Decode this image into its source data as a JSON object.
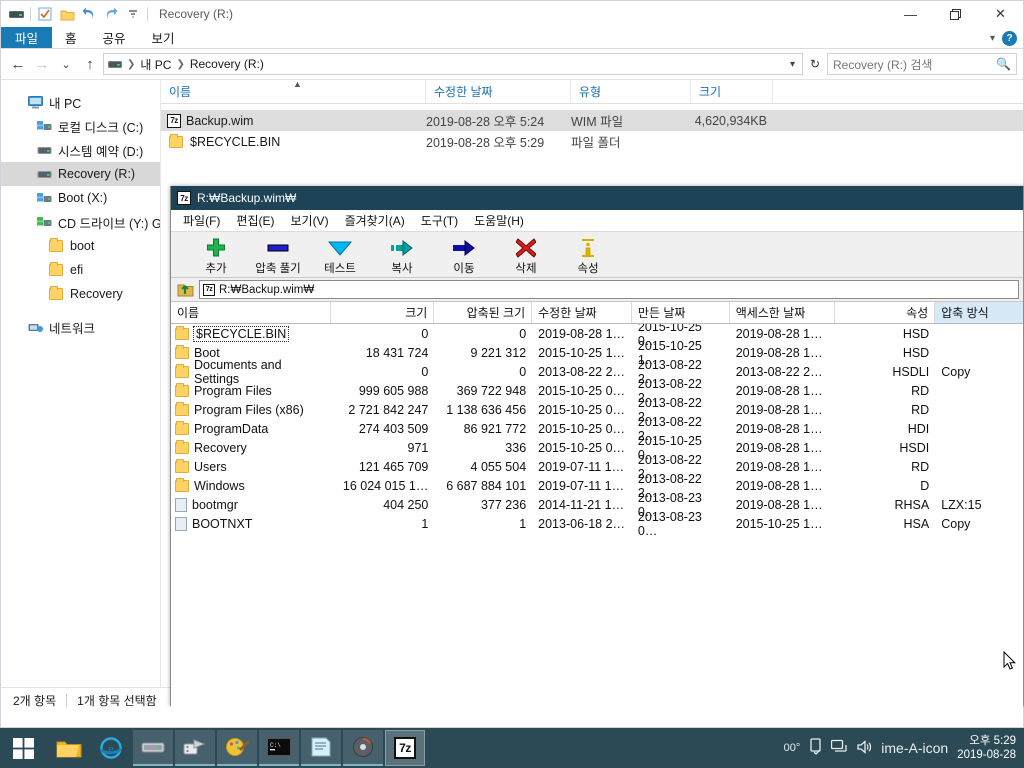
{
  "explorer": {
    "title": "Recovery (R:)",
    "quick_access": [
      "drive-icon",
      "properties-icon",
      "new-folder-icon",
      "undo-icon",
      "redo-icon",
      "customize-icon"
    ],
    "window_controls": {
      "minimize": "—",
      "maximize": "❐",
      "close": "✕"
    },
    "ribbon_tabs": [
      {
        "label": "파일",
        "active": true
      },
      {
        "label": "홈",
        "active": false
      },
      {
        "label": "공유",
        "active": false
      },
      {
        "label": "보기",
        "active": false
      }
    ],
    "ribbon_help": "?",
    "nav": {
      "back": "←",
      "forward": "→",
      "recent": "⌄",
      "up": "↑",
      "refresh": "↻"
    },
    "breadcrumb": [
      "내 PC",
      "Recovery (R:)"
    ],
    "search": {
      "placeholder": "Recovery (R:) 검색",
      "value": "",
      "icon": "search-icon"
    },
    "tree": [
      {
        "label": "내 PC",
        "icon": "pc-icon",
        "indent": 0,
        "selected": false
      },
      {
        "label": "로컬 디스크 (C:)",
        "icon": "hdd-icon",
        "indent": 1,
        "selected": false
      },
      {
        "label": "시스템 예약 (D:)",
        "icon": "drive-icon",
        "indent": 1,
        "selected": false
      },
      {
        "label": "Recovery (R:)",
        "icon": "drive-icon",
        "indent": 1,
        "selected": true
      },
      {
        "label": "Boot (X:)",
        "icon": "hdd-icon",
        "indent": 1,
        "selected": false
      },
      {
        "label": "CD 드라이브 (Y:) G",
        "icon": "cd-icon",
        "indent": 1,
        "selected": false
      },
      {
        "label": "boot",
        "icon": "folder-icon",
        "indent": 2,
        "selected": false
      },
      {
        "label": "efi",
        "icon": "folder-icon",
        "indent": 2,
        "selected": false
      },
      {
        "label": "Recovery",
        "icon": "folder-icon",
        "indent": 2,
        "selected": false
      },
      {
        "label": "네트워크",
        "icon": "network-icon",
        "indent": 0,
        "selected": false
      }
    ],
    "columns": [
      {
        "label": "이름",
        "sorted": true
      },
      {
        "label": "수정한 날짜",
        "sorted": false
      },
      {
        "label": "유형",
        "sorted": false
      },
      {
        "label": "크기",
        "sorted": false
      }
    ],
    "files": [
      {
        "name": "Backup.wim",
        "icon": "7z-file-icon",
        "modified": "2019-08-28 오후 5:24",
        "type": "WIM 파일",
        "size": "4,620,934KB",
        "selected": true
      },
      {
        "name": "$RECYCLE.BIN",
        "icon": "folder-icon",
        "modified": "2019-08-28 오후 5:29",
        "type": "파일 폴더",
        "size": "",
        "selected": false
      }
    ],
    "status": {
      "items": "2개 항목",
      "selected": "1개 항목 선택함"
    }
  },
  "sevenzip": {
    "title": "R:₩Backup.wim₩",
    "title_icon": "7z-icon",
    "menus": [
      "파일(F)",
      "편집(E)",
      "보기(V)",
      "즐겨찾기(A)",
      "도구(T)",
      "도움말(H)"
    ],
    "toolbar": [
      {
        "label": "추가",
        "icon": "plus-icon",
        "color": "#22b14c"
      },
      {
        "label": "압축 풀기",
        "icon": "minus-icon",
        "color": "#2020d0"
      },
      {
        "label": "테스트",
        "icon": "chevron-down-icon",
        "color": "#00b7ef"
      },
      {
        "label": "복사",
        "icon": "copy-arrow-icon",
        "color": "#00a2a2"
      },
      {
        "label": "이동",
        "icon": "move-arrow-icon",
        "color": "#1010a0"
      },
      {
        "label": "삭제",
        "icon": "delete-x-icon",
        "color": "#d32020"
      },
      {
        "label": "속성",
        "icon": "info-icon",
        "color": "#d4b000"
      }
    ],
    "up_button_icon": "up-folder-icon",
    "address": {
      "icon": "7z-icon",
      "value": "R:₩Backup.wim₩"
    },
    "columns": [
      {
        "label": "이름",
        "align": "left",
        "width": 160,
        "selected": false
      },
      {
        "label": "크기",
        "align": "right",
        "width": 104,
        "selected": false
      },
      {
        "label": "압축된 크기",
        "align": "right",
        "width": 98,
        "selected": false
      },
      {
        "label": "수정한 날짜",
        "align": "left",
        "width": 100,
        "selected": false
      },
      {
        "label": "만든 날짜",
        "align": "left",
        "width": 98,
        "selected": false
      },
      {
        "label": "액세스한 날짜",
        "align": "left",
        "width": 106,
        "selected": false
      },
      {
        "label": "속성",
        "align": "right",
        "width": 100,
        "selected": false
      },
      {
        "label": "압축 방식",
        "align": "left",
        "width": 88,
        "selected": true
      }
    ],
    "rows": [
      {
        "name": "$RECYCLE.BIN",
        "icon": "folder-icon",
        "focused": true,
        "size": "0",
        "packed": "0",
        "modified": "2019-08-28 1…",
        "created": "2015-10-25 0…",
        "accessed": "2019-08-28 1…",
        "attrs": "HSD",
        "method": ""
      },
      {
        "name": "Boot",
        "icon": "folder-icon",
        "focused": false,
        "size": "18 431 724",
        "packed": "9 221 312",
        "modified": "2015-10-25 1…",
        "created": "2015-10-25 1…",
        "accessed": "2019-08-28 1…",
        "attrs": "HSD",
        "method": ""
      },
      {
        "name": "Documents and Settings",
        "icon": "folder-icon",
        "focused": false,
        "size": "0",
        "packed": "0",
        "modified": "2013-08-22 2…",
        "created": "2013-08-22 2…",
        "accessed": "2013-08-22 2…",
        "attrs": "HSDLI",
        "method": "Copy"
      },
      {
        "name": "Program Files",
        "icon": "folder-icon",
        "focused": false,
        "size": "999 605 988",
        "packed": "369 722 948",
        "modified": "2015-10-25 0…",
        "created": "2013-08-22 2…",
        "accessed": "2019-08-28 1…",
        "attrs": "RD",
        "method": ""
      },
      {
        "name": "Program Files (x86)",
        "icon": "folder-icon",
        "focused": false,
        "size": "2 721 842 247",
        "packed": "1 138 636 456",
        "modified": "2015-10-25 0…",
        "created": "2013-08-22 2…",
        "accessed": "2019-08-28 1…",
        "attrs": "RD",
        "method": ""
      },
      {
        "name": "ProgramData",
        "icon": "folder-icon",
        "focused": false,
        "size": "274 403 509",
        "packed": "86 921 772",
        "modified": "2015-10-25 0…",
        "created": "2013-08-22 2…",
        "accessed": "2019-08-28 1…",
        "attrs": "HDI",
        "method": ""
      },
      {
        "name": "Recovery",
        "icon": "folder-icon",
        "focused": false,
        "size": "971",
        "packed": "336",
        "modified": "2015-10-25 0…",
        "created": "2015-10-25 0…",
        "accessed": "2019-08-28 1…",
        "attrs": "HSDI",
        "method": ""
      },
      {
        "name": "Users",
        "icon": "folder-icon",
        "focused": false,
        "size": "121 465 709",
        "packed": "4 055 504",
        "modified": "2019-07-11 1…",
        "created": "2013-08-22 2…",
        "accessed": "2019-08-28 1…",
        "attrs": "RD",
        "method": ""
      },
      {
        "name": "Windows",
        "icon": "folder-icon",
        "focused": false,
        "size": "16 024 015 1…",
        "packed": "6 687 884 101",
        "modified": "2019-07-11 1…",
        "created": "2013-08-22 2…",
        "accessed": "2019-08-28 1…",
        "attrs": "D",
        "method": ""
      },
      {
        "name": "bootmgr",
        "icon": "file-icon",
        "focused": false,
        "size": "404 250",
        "packed": "377 236",
        "modified": "2014-11-21 1…",
        "created": "2013-08-23 0…",
        "accessed": "2019-08-28 1…",
        "attrs": "RHSA",
        "method": "LZX:15"
      },
      {
        "name": "BOOTNXT",
        "icon": "file-icon",
        "focused": false,
        "size": "1",
        "packed": "1",
        "modified": "2013-06-18 2…",
        "created": "2013-08-23 0…",
        "accessed": "2015-10-25 1…",
        "attrs": "HSA",
        "method": "Copy"
      }
    ]
  },
  "taskbar": {
    "start_icon": "windows-start-icon",
    "items": [
      {
        "icon": "file-explorer-icon",
        "name": "file-explorer",
        "state": "pinned"
      },
      {
        "icon": "internet-explorer-icon",
        "name": "internet-explorer",
        "state": "pinned"
      },
      {
        "icon": "drive-icon",
        "name": "removable-drive",
        "state": "running"
      },
      {
        "icon": "imaging-tool-icon",
        "name": "imaging-tool",
        "state": "running"
      },
      {
        "icon": "paint-tool-icon",
        "name": "paint-tool",
        "state": "running"
      },
      {
        "icon": "console-icon",
        "name": "command-prompt",
        "state": "running"
      },
      {
        "icon": "notepad-icon",
        "name": "notepad",
        "state": "running"
      },
      {
        "icon": "disk-tool-icon",
        "name": "disk-tool",
        "state": "running"
      },
      {
        "icon": "7z-icon",
        "name": "seven-zip",
        "state": "active"
      }
    ],
    "tray": [
      "00°",
      "usb-icon",
      "network-icon",
      "volume-icon",
      "ime-A-icon"
    ],
    "clock": {
      "time": "오후 5:29",
      "date": "2019-08-28"
    }
  }
}
